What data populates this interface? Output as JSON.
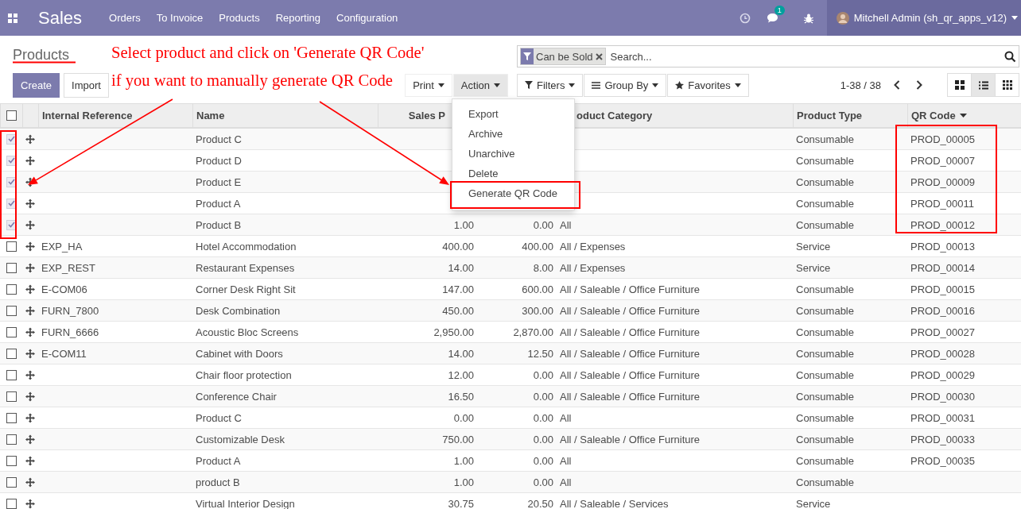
{
  "navbar": {
    "app_title": "Sales",
    "menu": [
      "Orders",
      "To Invoice",
      "Products",
      "Reporting",
      "Configuration"
    ],
    "chat_badge": "1",
    "user": "Mitchell Admin (sh_qr_apps_v12)"
  },
  "control_panel": {
    "breadcrumb": "Products",
    "buttons": [
      "Create",
      "Import"
    ],
    "print": "Print",
    "action": "Action",
    "action_menu": [
      {
        "label": "Export"
      },
      {
        "label": "Archive"
      },
      {
        "label": "Unarchive"
      },
      {
        "label": "Delete"
      },
      {
        "label": "Generate QR Code"
      }
    ],
    "search": {
      "facet": "Can be Sold",
      "placeholder": "Search..."
    },
    "filters": [
      "Filters",
      "Group By",
      "Favorites"
    ],
    "pager": "1-38 / 38",
    "views": [
      {
        "kind": "kanban",
        "selected": false
      },
      {
        "kind": "list",
        "selected": true
      },
      {
        "kind": "pivot",
        "selected": false
      }
    ]
  },
  "annotation": {
    "lines": [
      "Select product and click on 'Generate QR Code'",
      "if you want to manually generate QR Code"
    ]
  },
  "table": {
    "header_checked": false,
    "columns": [
      {
        "label": "Internal Reference",
        "sorted": false
      },
      {
        "label": "Name",
        "sorted": false
      },
      {
        "label": "Sales P",
        "sorted": false
      },
      {
        "label": "oduct Category",
        "sorted": false
      },
      {
        "label": "Product Type",
        "sorted": false
      },
      {
        "label": "QR Code",
        "sorted": true
      }
    ],
    "rows": [
      {
        "checked": true,
        "name": "Product C",
        "type": "Consumable",
        "qr_code": "PROD_00005"
      },
      {
        "checked": true,
        "name": "Product D",
        "type": "Consumable",
        "qr_code": "PROD_00007"
      },
      {
        "checked": true,
        "name": "Product E",
        "type": "Consumable",
        "qr_code": "PROD_00009"
      },
      {
        "checked": true,
        "name": "Product A",
        "type": "Consumable",
        "qr_code": "PROD_00011"
      },
      {
        "checked": true,
        "name": "Product B",
        "sales_price": "1.00",
        "cost": "0.00",
        "category": "All",
        "type": "Consumable",
        "qr_code": "PROD_00012"
      },
      {
        "checked": false,
        "ref": "EXP_HA",
        "name": "Hotel Accommodation",
        "sales_price": "400.00",
        "cost": "400.00",
        "category": "All / Expenses",
        "type": "Service",
        "qr_code": "PROD_00013"
      },
      {
        "checked": false,
        "ref": "EXP_REST",
        "name": "Restaurant Expenses",
        "sales_price": "14.00",
        "cost": "8.00",
        "category": "All / Expenses",
        "type": "Service",
        "qr_code": "PROD_00014"
      },
      {
        "checked": false,
        "ref": "E-COM06",
        "name": "Corner Desk Right Sit",
        "sales_price": "147.00",
        "cost": "600.00",
        "category": "All / Saleable / Office Furniture",
        "type": "Consumable",
        "qr_code": "PROD_00015"
      },
      {
        "checked": false,
        "ref": "FURN_7800",
        "name": "Desk Combination",
        "sales_price": "450.00",
        "cost": "300.00",
        "category": "All / Saleable / Office Furniture",
        "type": "Consumable",
        "qr_code": "PROD_00016"
      },
      {
        "checked": false,
        "ref": "FURN_6666",
        "name": "Acoustic Bloc Screens",
        "sales_price": "2,950.00",
        "cost": "2,870.00",
        "category": "All / Saleable / Office Furniture",
        "type": "Consumable",
        "qr_code": "PROD_00027"
      },
      {
        "checked": false,
        "ref": "E-COM11",
        "name": "Cabinet with Doors",
        "sales_price": "14.00",
        "cost": "12.50",
        "category": "All / Saleable / Office Furniture",
        "type": "Consumable",
        "qr_code": "PROD_00028"
      },
      {
        "checked": false,
        "name": "Chair floor protection",
        "sales_price": "12.00",
        "cost": "0.00",
        "category": "All / Saleable / Office Furniture",
        "type": "Consumable",
        "qr_code": "PROD_00029"
      },
      {
        "checked": false,
        "name": "Conference Chair",
        "sales_price": "16.50",
        "cost": "0.00",
        "category": "All / Saleable / Office Furniture",
        "type": "Consumable",
        "qr_code": "PROD_00030"
      },
      {
        "checked": false,
        "name": "Product C",
        "sales_price": "0.00",
        "cost": "0.00",
        "category": "All",
        "type": "Consumable",
        "qr_code": "PROD_00031"
      },
      {
        "checked": false,
        "name": "Customizable Desk",
        "sales_price": "750.00",
        "cost": "0.00",
        "category": "All / Saleable / Office Furniture",
        "type": "Consumable",
        "qr_code": "PROD_00033"
      },
      {
        "checked": false,
        "name": "Product A",
        "sales_price": "1.00",
        "cost": "0.00",
        "category": "All",
        "type": "Consumable",
        "qr_code": "PROD_00035"
      },
      {
        "checked": false,
        "name": "product B",
        "sales_price": "1.00",
        "cost": "0.00",
        "category": "All",
        "type": "Consumable"
      },
      {
        "checked": false,
        "name": "Virtual Interior Design",
        "sales_price": "30.75",
        "cost": "20.50",
        "category": "All / Saleable / Services",
        "type": "Service"
      }
    ]
  }
}
